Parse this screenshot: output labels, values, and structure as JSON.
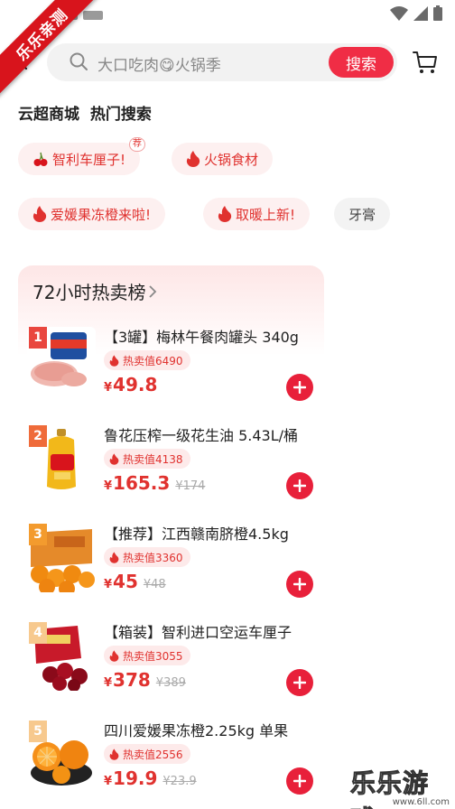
{
  "watermark": {
    "ribbon": "乐乐亲测",
    "logo": "乐乐游戏",
    "url": "www.6ll.com"
  },
  "search": {
    "placeholder_text": "大口吃肉😋火锅季",
    "button_label": "搜索"
  },
  "section": {
    "title": "云超商城  热门搜索"
  },
  "hot_tags": [
    {
      "label": "智利车厘子!",
      "badge": "荐",
      "icon": "cherry-icon"
    },
    {
      "label": "火锅食材",
      "icon": "fire-icon"
    },
    {
      "label": "爱媛果冻橙来啦!",
      "icon": "fire-icon"
    },
    {
      "label": "取暖上新!",
      "icon": "fire-icon"
    },
    {
      "label": "牙膏"
    }
  ],
  "ranking": {
    "title": "72小时热卖榜",
    "currency": "¥",
    "items": [
      {
        "rank": "1",
        "name": "【3罐】梅林午餐肉罐头 340g",
        "hot": "热卖值6490",
        "price": "49.8",
        "old_price": ""
      },
      {
        "rank": "2",
        "name": "鲁花压榨一级花生油 5.43L/桶",
        "hot": "热卖值4138",
        "price": "165.3",
        "old_price": "¥174"
      },
      {
        "rank": "3",
        "name": "【推荐】江西赣南脐橙4.5kg",
        "hot": "热卖值3360",
        "price": "45",
        "old_price": "¥48"
      },
      {
        "rank": "4",
        "name": "【箱装】智利进口空运车厘子",
        "hot": "热卖值3055",
        "price": "378",
        "old_price": "¥389"
      },
      {
        "rank": "5",
        "name": "四川爱媛果冻橙2.25kg 单果",
        "hot": "热卖值2556",
        "price": "19.9",
        "old_price": "¥23.9"
      }
    ]
  },
  "colors": {
    "accent": "#f02d45",
    "price": "#e0322f",
    "tag_bg": "#fdf0f0"
  }
}
